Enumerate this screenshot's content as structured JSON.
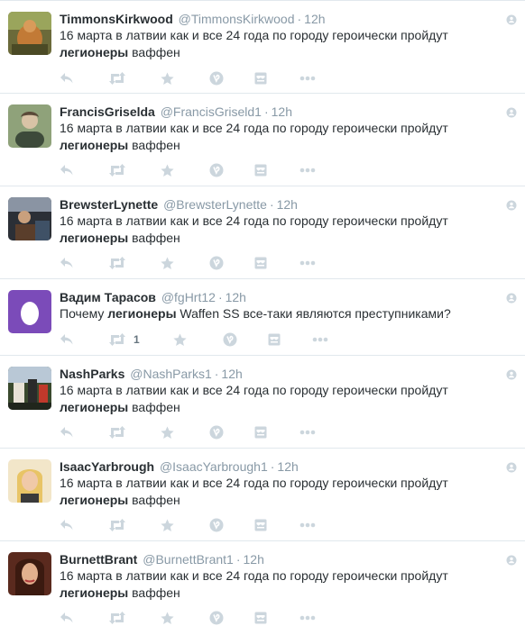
{
  "tweets": [
    {
      "name": "TimmonsKirkwood",
      "handle": "@TimmonsKirkwood",
      "dot": "·",
      "time": "12h",
      "pre": "16 марта в латвии как и все 24 года по городу героически пройдут ",
      "bold": "легионеры",
      "post": " ваффен",
      "retweet_count": ""
    },
    {
      "name": "FrancisGriselda",
      "handle": "@FrancisGriseld1",
      "dot": "·",
      "time": "12h",
      "pre": "16 марта в латвии как и все 24 года по городу героически пройдут ",
      "bold": "легионеры",
      "post": " ваффен",
      "retweet_count": ""
    },
    {
      "name": "BrewsterLynette",
      "handle": "@BrewsterLynette",
      "dot": "·",
      "time": "12h",
      "pre": "16 марта в латвии как и все 24 года по городу героически пройдут ",
      "bold": "легионеры",
      "post": " ваффен",
      "retweet_count": ""
    },
    {
      "name": "Вадим Тарасов",
      "handle": "@fgHrt12",
      "dot": "·",
      "time": "12h",
      "pre": "Почему ",
      "bold": "легионеры",
      "post": " Waffen SS все-таки являются преступниками?",
      "retweet_count": "1"
    },
    {
      "name": "NashParks",
      "handle": "@NashParks1",
      "dot": "·",
      "time": "12h",
      "pre": "16 марта в латвии как и все 24 года по городу героически пройдут ",
      "bold": "легионеры",
      "post": " ваффен",
      "retweet_count": ""
    },
    {
      "name": "IsaacYarbrough",
      "handle": "@IsaacYarbrough1",
      "dot": "·",
      "time": "12h",
      "pre": "16 марта в латвии как и все 24 года по городу героически пройдут ",
      "bold": "легионеры",
      "post": " ваффен",
      "retweet_count": ""
    },
    {
      "name": "BurnettBrant",
      "handle": "@BurnettBrant1",
      "dot": "·",
      "time": "12h",
      "pre": "16 марта в латвии как и все 24 года по городу героически пройдут ",
      "bold": "легионеры",
      "post": " ваффен",
      "retweet_count": ""
    }
  ],
  "icons": {
    "reply": "reply-icon",
    "retweet": "retweet-icon",
    "favorite": "star-icon",
    "vine": "vine-icon",
    "summary": "summary-card-icon",
    "more": "more-icon",
    "corner": "follow-circle-icon"
  },
  "colors": {
    "icon": "#ccd6dd",
    "text": "#292f33",
    "muted": "#8899a6",
    "divider": "#e1e8ed",
    "egg": "#7b4bb9"
  }
}
